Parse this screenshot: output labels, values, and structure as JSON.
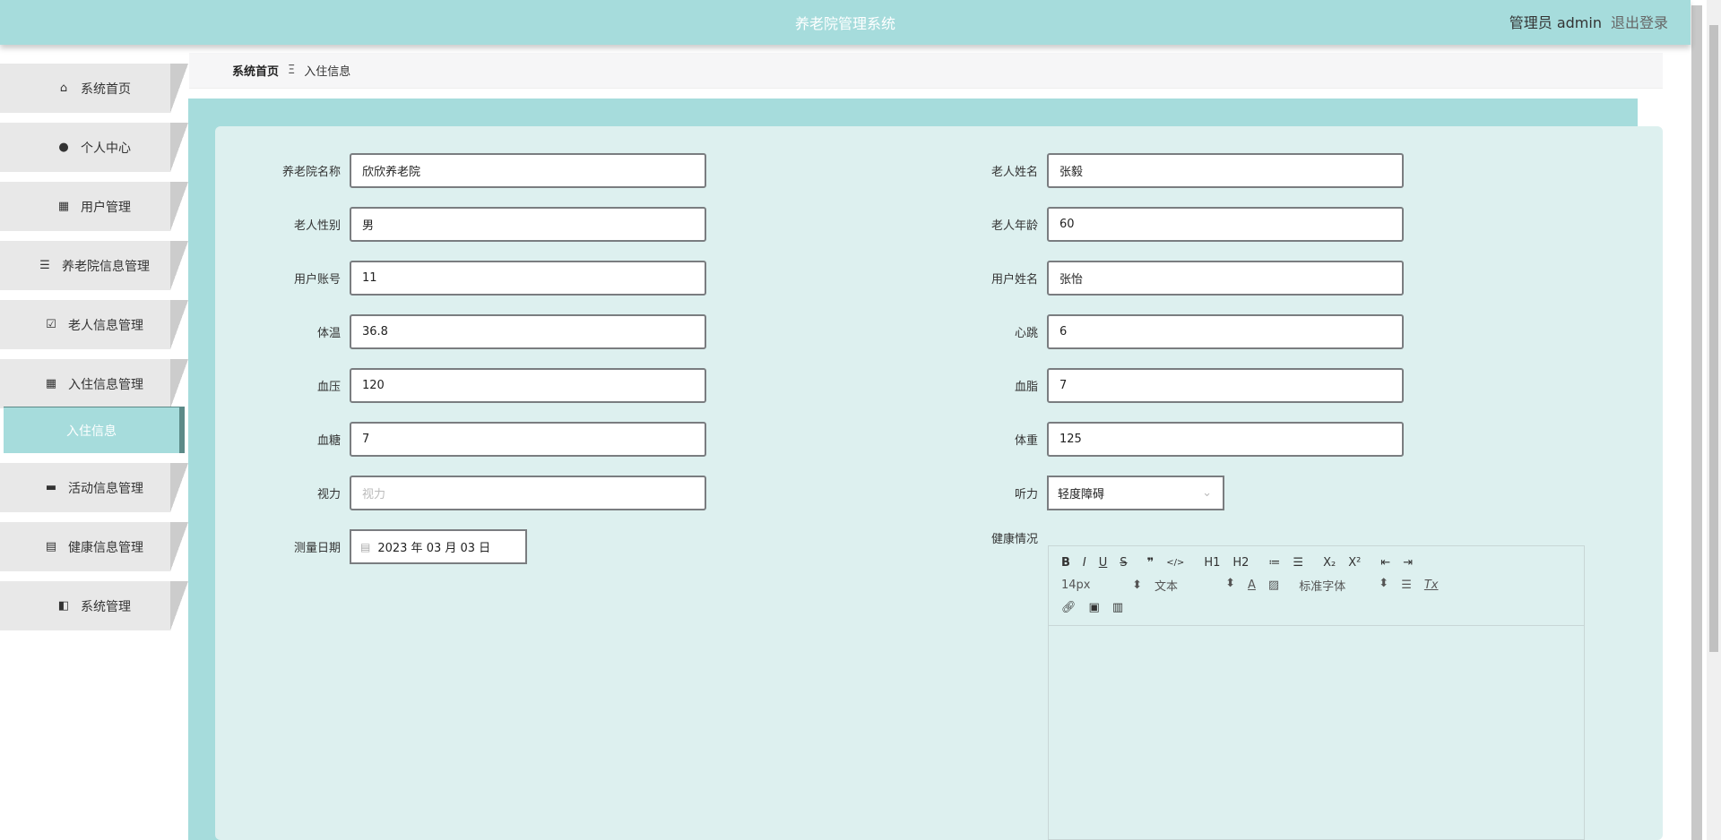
{
  "header": {
    "title": "养老院管理系统",
    "user": "管理员 admin",
    "logout": "退出登录"
  },
  "sidebar": {
    "items": [
      {
        "label": "系统首页",
        "icon": "home-icon"
      },
      {
        "label": "个人中心",
        "icon": "user-icon"
      },
      {
        "label": "用户管理",
        "icon": "grid-icon"
      },
      {
        "label": "养老院信息管理",
        "icon": "list-icon"
      },
      {
        "label": "老人信息管理",
        "icon": "clipboard-check-icon"
      },
      {
        "label": "入住信息管理",
        "icon": "grid-icon"
      },
      {
        "label": "入住信息",
        "icon": ""
      },
      {
        "label": "活动信息管理",
        "icon": "monitor-icon"
      },
      {
        "label": "健康信息管理",
        "icon": "clipboard-icon"
      },
      {
        "label": "系统管理",
        "icon": "wallet-icon"
      }
    ]
  },
  "breadcrumb": {
    "home": "系统首页",
    "sep": "Ξ",
    "current": "入住信息"
  },
  "form": {
    "nursing_home": {
      "label": "养老院名称",
      "value": "欣欣养老院"
    },
    "elder_name": {
      "label": "老人姓名",
      "value": "张毅"
    },
    "gender": {
      "label": "老人性别",
      "value": "男"
    },
    "age": {
      "label": "老人年龄",
      "value": "60"
    },
    "account": {
      "label": "用户账号",
      "value": "11"
    },
    "user_name": {
      "label": "用户姓名",
      "value": "张怡"
    },
    "temperature": {
      "label": "体温",
      "value": "36.8"
    },
    "heart_rate": {
      "label": "心跳",
      "value": "6"
    },
    "blood_pressure": {
      "label": "血压",
      "value": "120"
    },
    "blood_lipid": {
      "label": "血脂",
      "value": "7"
    },
    "blood_sugar": {
      "label": "血糖",
      "value": "7"
    },
    "weight": {
      "label": "体重",
      "value": "125"
    },
    "vision": {
      "label": "视力",
      "placeholder": "视力"
    },
    "hearing": {
      "label": "听力",
      "value": "轻度障碍"
    },
    "date": {
      "label": "测量日期",
      "value": "2023 年 03 月 03 日"
    },
    "health": {
      "label": "健康情况"
    }
  },
  "editor": {
    "row1": [
      "B",
      "I",
      "U",
      "S",
      "❞",
      "</>",
      "H1",
      "H2",
      "≔",
      "☰",
      "X₂",
      "X²",
      "⇤",
      "⇥"
    ],
    "font_size": "14px",
    "text_type": "文本",
    "font_family": "标准字体",
    "clear": "Tx"
  }
}
